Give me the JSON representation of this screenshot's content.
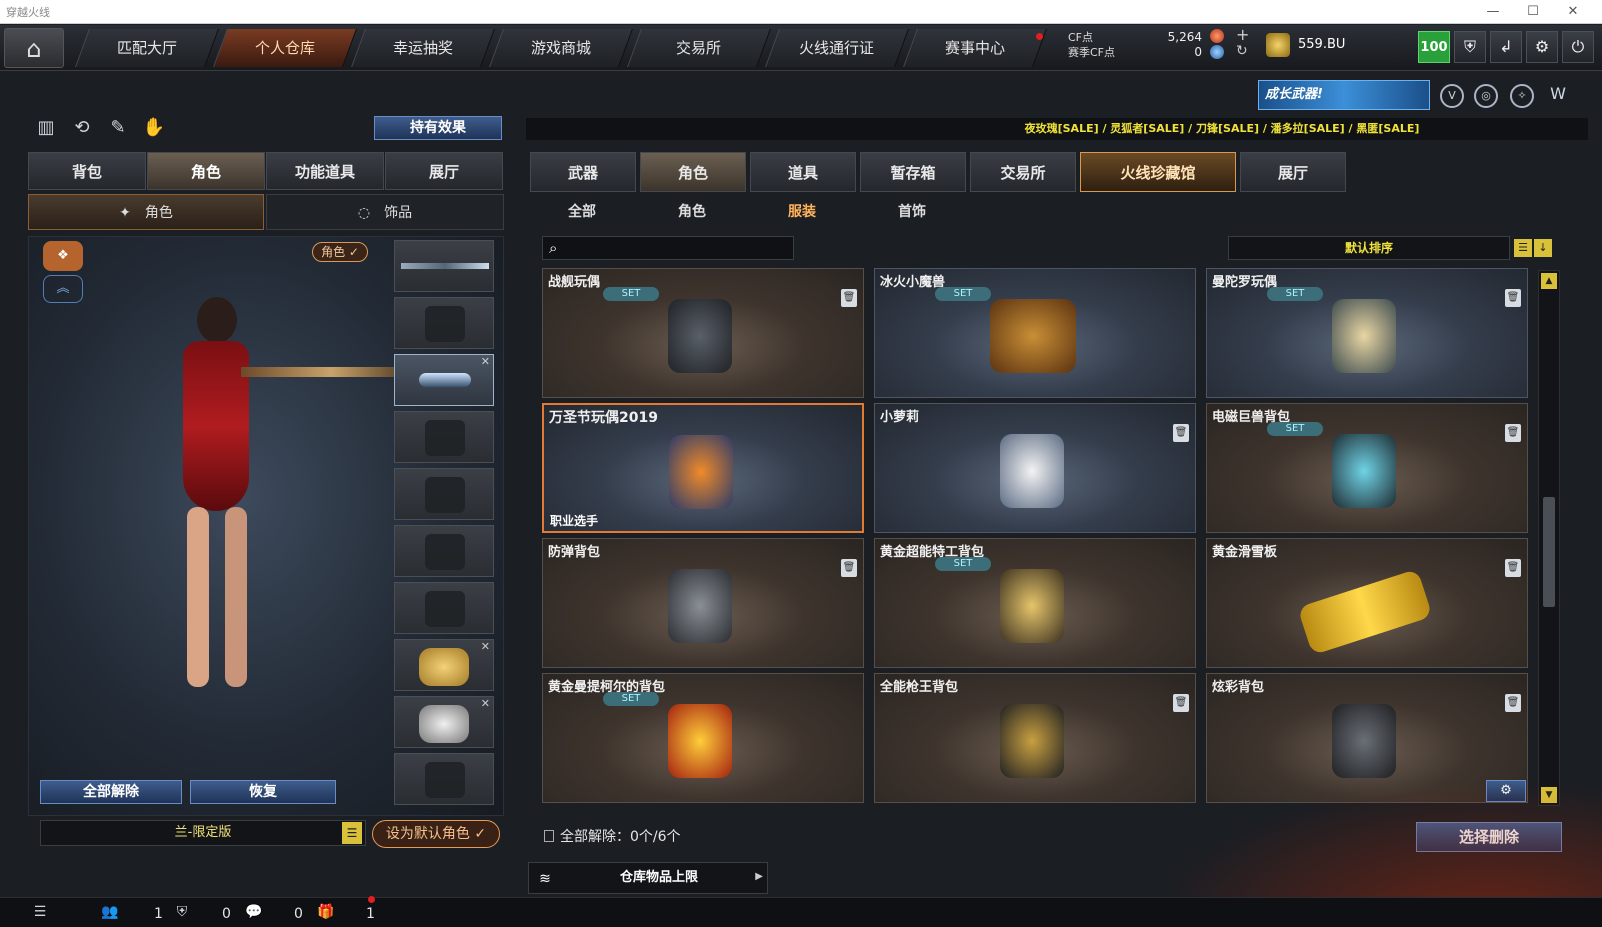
{
  "window": {
    "title": "穿越火线",
    "controls": [
      "—",
      "☐",
      "✕"
    ]
  },
  "nav": {
    "items": [
      "匹配大厅",
      "个人仓库",
      "幸运抽奖",
      "游戏商城",
      "交易所",
      "火线通行证",
      "赛事中心"
    ],
    "active_index": 1
  },
  "currency": {
    "cf_label": "CF点",
    "cf_value": "5,264",
    "match_cf_label": "赛季CF点",
    "match_cf_value": "0",
    "bu_value": "559.BU",
    "level": "100",
    "plus": "+",
    "refresh": "↻"
  },
  "banner": {
    "text": "成长武器!"
  },
  "left": {
    "hold_effect_label": "持有效果",
    "tabs": [
      "背包",
      "角色",
      "功能道具",
      "展厅"
    ],
    "active_tab": 1,
    "subtabs": [
      "角色",
      "饰品"
    ],
    "char_badge": "角色 ✓",
    "btn_release_all": "全部解除",
    "btn_restore": "恢复",
    "char_name": "兰-限定版",
    "default_btn": "设为默认角色 ✓"
  },
  "right": {
    "sale_text": "夜玫瑰[SALE] / 灵狐者[SALE] / 刀锋[SALE] / 潘多拉[SALE] / 黑匿[SALE]",
    "tabs": [
      "武器",
      "角色",
      "道具",
      "暂存箱",
      "交易所",
      "火线珍藏馆",
      "展厅"
    ],
    "subtabs": [
      "全部",
      "角色",
      "服装",
      "首饰"
    ],
    "active_subtab": 2,
    "sort_label": "默认排序",
    "items": [
      {
        "name": "战舰玩偶",
        "set": "SET",
        "trash": true,
        "tag": ""
      },
      {
        "name": "冰火小魔兽",
        "set": "SET",
        "trash": false,
        "tag": ""
      },
      {
        "name": "曼陀罗玩偶",
        "set": "SET",
        "trash": true,
        "tag": ""
      },
      {
        "name": "万圣节玩偶2019",
        "set": "",
        "trash": false,
        "tag": "职业选手"
      },
      {
        "name": "小萝莉",
        "set": "",
        "trash": true,
        "tag": ""
      },
      {
        "name": "电磁巨兽背包",
        "set": "SET",
        "trash": true,
        "tag": ""
      },
      {
        "name": "防弹背包",
        "set": "",
        "trash": true,
        "tag": ""
      },
      {
        "name": "黄金超能特工背包",
        "set": "SET",
        "trash": false,
        "tag": ""
      },
      {
        "name": "黄金滑雪板",
        "set": "",
        "trash": true,
        "tag": ""
      },
      {
        "name": "黄金曼提柯尔的背包",
        "set": "SET",
        "trash": false,
        "tag": ""
      },
      {
        "name": "全能枪王背包",
        "set": "",
        "trash": true,
        "tag": ""
      },
      {
        "name": "炫彩背包",
        "set": "",
        "trash": true,
        "tag": ""
      }
    ],
    "release_info": "全部解除：0个/6个",
    "select_delete": "选择删除",
    "storage_limit": "仓库物品上限"
  },
  "statusbar": {
    "counts": [
      "1",
      "0",
      "0",
      "1"
    ]
  }
}
